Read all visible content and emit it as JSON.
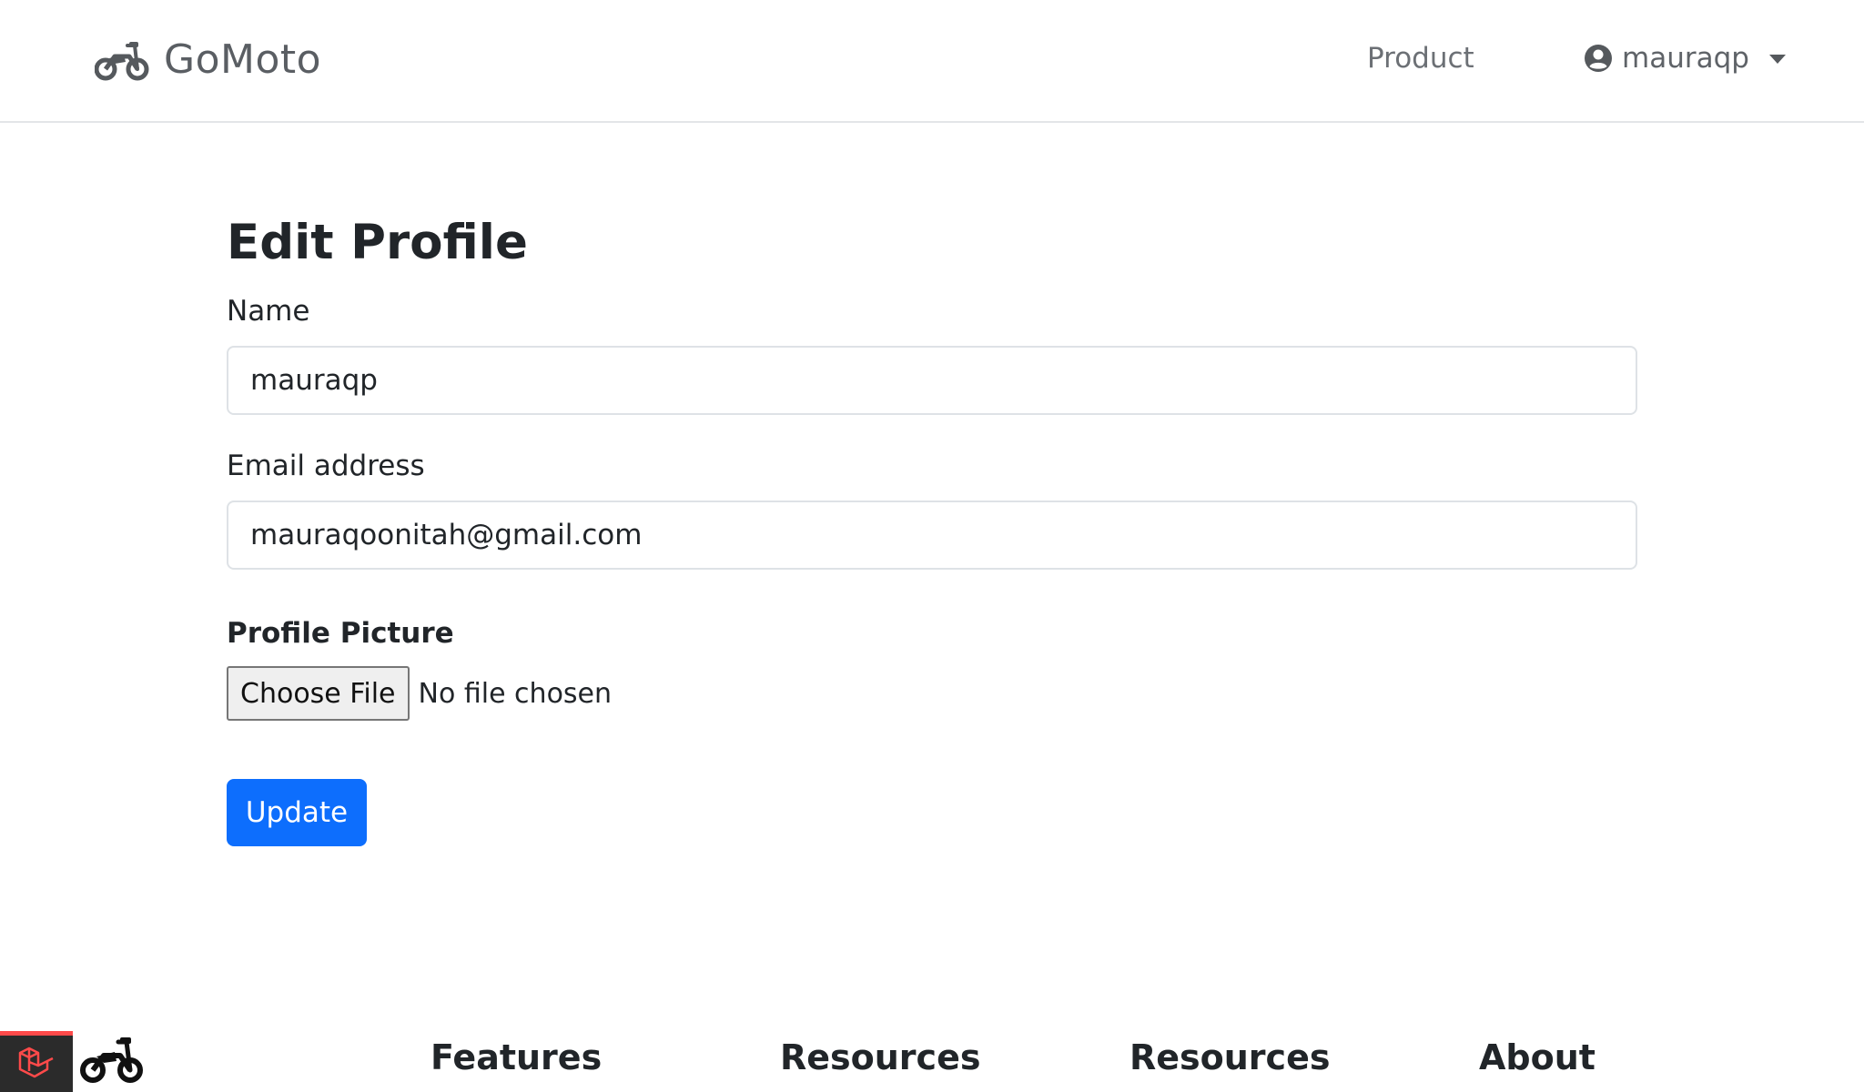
{
  "navbar": {
    "brand": "GoMoto",
    "brand_icon": "motorcycle-icon",
    "product_link": "Product",
    "user_name": "mauraqp",
    "user_icon": "user-circle-icon"
  },
  "form": {
    "title": "Edit Profile",
    "name_label": "Name",
    "name_value": "mauraqp",
    "email_label": "Email address",
    "email_value": "mauraqoonitah@gmail.com",
    "picture_label": "Profile Picture",
    "file_button": "Choose File",
    "file_status": "No file chosen",
    "submit_label": "Update"
  },
  "footer": {
    "badge_icon": "laravel-icon",
    "logo_icon": "motorcycle-icon",
    "headings": [
      "Features",
      "Resources",
      "Resources",
      "About"
    ]
  },
  "colors": {
    "primary": "#0d6efd",
    "badge_bg": "#2b2b2b",
    "badge_accent": "#ff4a4a"
  }
}
